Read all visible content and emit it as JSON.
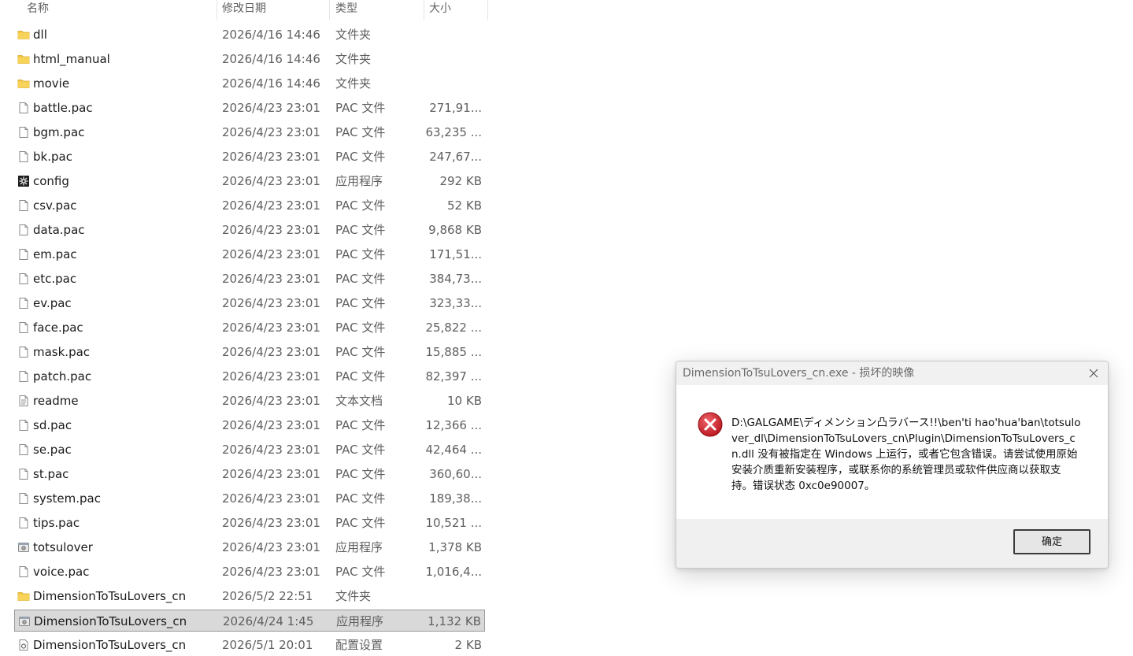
{
  "explorer": {
    "columns": {
      "name": "名称",
      "date": "修改日期",
      "type": "类型",
      "size": "大小"
    },
    "rows": [
      {
        "name": "dll",
        "date": "2026/4/16 14:46",
        "type": "文件夹",
        "size": "",
        "icon": "folder-icon"
      },
      {
        "name": "html_manual",
        "date": "2026/4/16 14:46",
        "type": "文件夹",
        "size": "",
        "icon": "folder-icon"
      },
      {
        "name": "movie",
        "date": "2026/4/16 14:46",
        "type": "文件夹",
        "size": "",
        "icon": "folder-icon"
      },
      {
        "name": "battle.pac",
        "date": "2026/4/23 23:01",
        "type": "PAC 文件",
        "size": "271,91...",
        "icon": "file-icon"
      },
      {
        "name": "bgm.pac",
        "date": "2026/4/23 23:01",
        "type": "PAC 文件",
        "size": "63,235 ...",
        "icon": "file-icon"
      },
      {
        "name": "bk.pac",
        "date": "2026/4/23 23:01",
        "type": "PAC 文件",
        "size": "247,67...",
        "icon": "file-icon"
      },
      {
        "name": "config",
        "date": "2026/4/23 23:01",
        "type": "应用程序",
        "size": "292 KB",
        "icon": "config-app-icon"
      },
      {
        "name": "csv.pac",
        "date": "2026/4/23 23:01",
        "type": "PAC 文件",
        "size": "52 KB",
        "icon": "file-icon"
      },
      {
        "name": "data.pac",
        "date": "2026/4/23 23:01",
        "type": "PAC 文件",
        "size": "9,868 KB",
        "icon": "file-icon"
      },
      {
        "name": "em.pac",
        "date": "2026/4/23 23:01",
        "type": "PAC 文件",
        "size": "171,51...",
        "icon": "file-icon"
      },
      {
        "name": "etc.pac",
        "date": "2026/4/23 23:01",
        "type": "PAC 文件",
        "size": "384,73...",
        "icon": "file-icon"
      },
      {
        "name": "ev.pac",
        "date": "2026/4/23 23:01",
        "type": "PAC 文件",
        "size": "323,33...",
        "icon": "file-icon"
      },
      {
        "name": "face.pac",
        "date": "2026/4/23 23:01",
        "type": "PAC 文件",
        "size": "25,822 ...",
        "icon": "file-icon"
      },
      {
        "name": "mask.pac",
        "date": "2026/4/23 23:01",
        "type": "PAC 文件",
        "size": "15,885 ...",
        "icon": "file-icon"
      },
      {
        "name": "patch.pac",
        "date": "2026/4/23 23:01",
        "type": "PAC 文件",
        "size": "82,397 ...",
        "icon": "file-icon"
      },
      {
        "name": "readme",
        "date": "2026/4/23 23:01",
        "type": "文本文档",
        "size": "10 KB",
        "icon": "text-file-icon"
      },
      {
        "name": "sd.pac",
        "date": "2026/4/23 23:01",
        "type": "PAC 文件",
        "size": "12,366 ...",
        "icon": "file-icon"
      },
      {
        "name": "se.pac",
        "date": "2026/4/23 23:01",
        "type": "PAC 文件",
        "size": "42,464 ...",
        "icon": "file-icon"
      },
      {
        "name": "st.pac",
        "date": "2026/4/23 23:01",
        "type": "PAC 文件",
        "size": "360,60...",
        "icon": "file-icon"
      },
      {
        "name": "system.pac",
        "date": "2026/4/23 23:01",
        "type": "PAC 文件",
        "size": "189,38...",
        "icon": "file-icon"
      },
      {
        "name": "tips.pac",
        "date": "2026/4/23 23:01",
        "type": "PAC 文件",
        "size": "10,521 ...",
        "icon": "file-icon"
      },
      {
        "name": "totsulover",
        "date": "2026/4/23 23:01",
        "type": "应用程序",
        "size": "1,378 KB",
        "icon": "app-icon"
      },
      {
        "name": "voice.pac",
        "date": "2026/4/23 23:01",
        "type": "PAC 文件",
        "size": "1,016,4...",
        "icon": "file-icon"
      },
      {
        "name": "DimensionToTsuLovers_cn",
        "date": "2026/5/2 22:51",
        "type": "文件夹",
        "size": "",
        "icon": "folder-icon"
      },
      {
        "name": "DimensionToTsuLovers_cn",
        "date": "2026/4/24 1:45",
        "type": "应用程序",
        "size": "1,132 KB",
        "icon": "app-icon",
        "selected": true
      },
      {
        "name": "DimensionToTsuLovers_cn",
        "date": "2026/5/1 20:01",
        "type": "配置设置",
        "size": "2 KB",
        "icon": "settings-file-icon"
      }
    ]
  },
  "dialog": {
    "title": "DimensionToTsuLovers_cn.exe - 损坏的映像",
    "message": "D:\\GALGAME\\ディメンション凸ラバース!!\\ben'ti hao'hua'ban\\totsulover_dl\\DimensionToTsuLovers_cn\\Plugin\\DimensionToTsuLovers_cn.dll 没有被指定在 Windows 上运行，或者它包含错误。请尝试使用原始安装介质重新安装程序，或联系你的系统管理员或软件供应商以获取支持。错误状态 0xc0e90007。",
    "ok_label": "确定",
    "icon": "error-icon",
    "close_icon": "close-icon"
  },
  "colors": {
    "folder": "#f3c43f",
    "error_red": "#d3262d",
    "selection": "#d9d9d9"
  }
}
